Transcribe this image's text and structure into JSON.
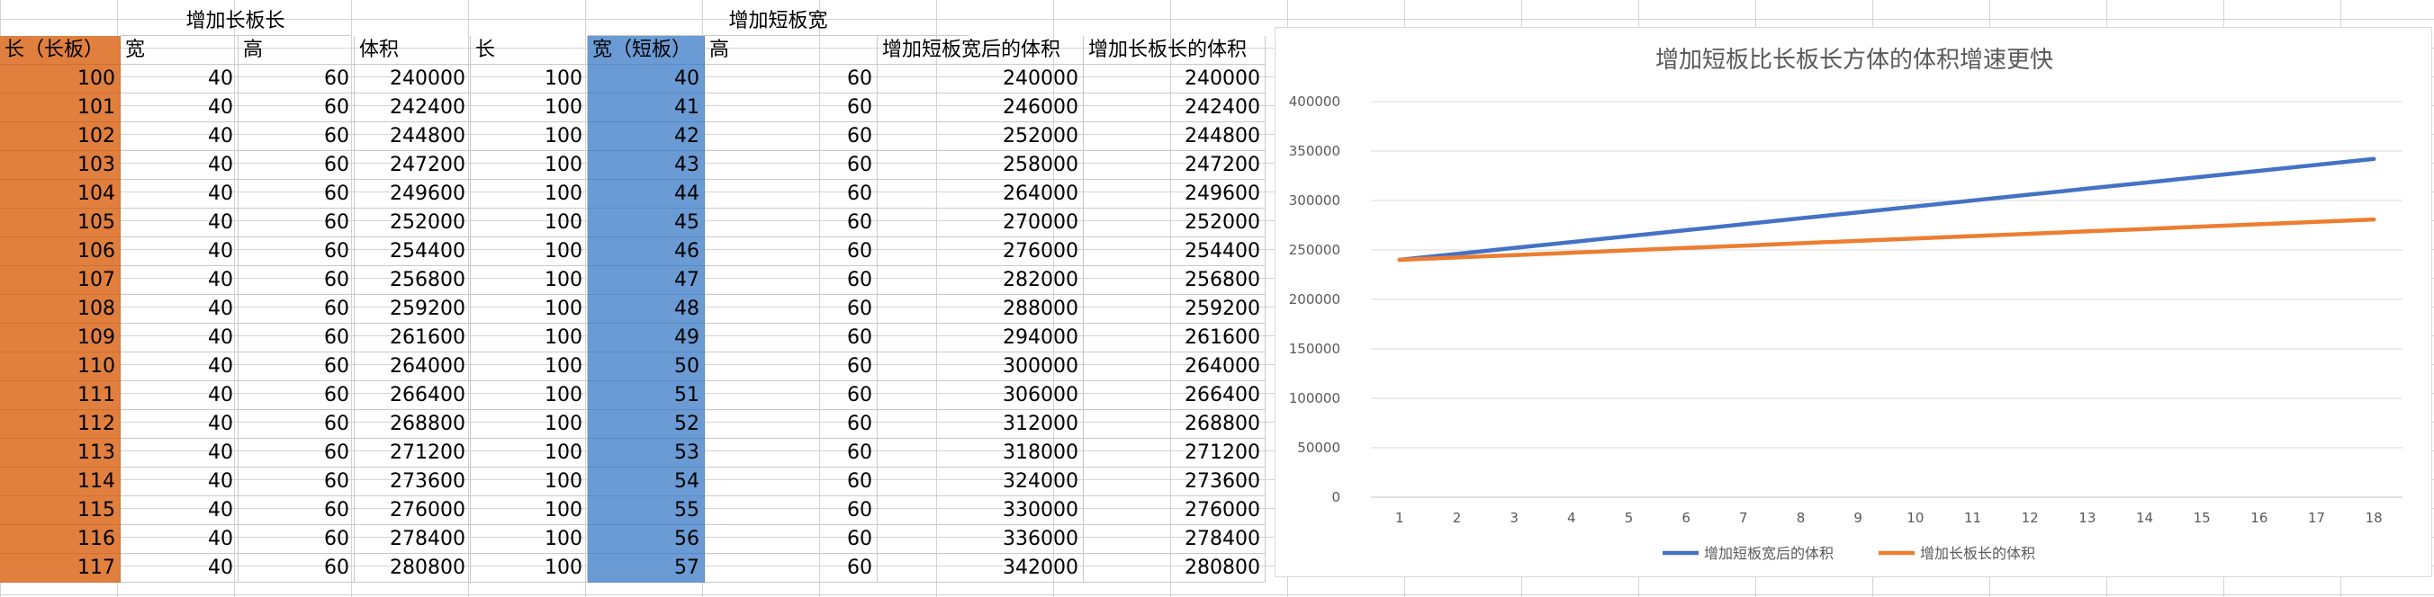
{
  "sheet": {
    "group_long_title": "增加长板长",
    "group_short_title": "增加短板宽",
    "headers": [
      "长（长板）",
      "宽",
      "高",
      "体积",
      "长",
      "宽（短板）",
      "高",
      "增加短板宽后的体积",
      "增加长板长的体积"
    ],
    "rows": [
      [
        "100",
        "40",
        "60",
        "240000",
        "100",
        "40",
        "60",
        "240000",
        "240000"
      ],
      [
        "101",
        "40",
        "60",
        "242400",
        "100",
        "41",
        "60",
        "246000",
        "242400"
      ],
      [
        "102",
        "40",
        "60",
        "244800",
        "100",
        "42",
        "60",
        "252000",
        "244800"
      ],
      [
        "103",
        "40",
        "60",
        "247200",
        "100",
        "43",
        "60",
        "258000",
        "247200"
      ],
      [
        "104",
        "40",
        "60",
        "249600",
        "100",
        "44",
        "60",
        "264000",
        "249600"
      ],
      [
        "105",
        "40",
        "60",
        "252000",
        "100",
        "45",
        "60",
        "270000",
        "252000"
      ],
      [
        "106",
        "40",
        "60",
        "254400",
        "100",
        "46",
        "60",
        "276000",
        "254400"
      ],
      [
        "107",
        "40",
        "60",
        "256800",
        "100",
        "47",
        "60",
        "282000",
        "256800"
      ],
      [
        "108",
        "40",
        "60",
        "259200",
        "100",
        "48",
        "60",
        "288000",
        "259200"
      ],
      [
        "109",
        "40",
        "60",
        "261600",
        "100",
        "49",
        "60",
        "294000",
        "261600"
      ],
      [
        "110",
        "40",
        "60",
        "264000",
        "100",
        "50",
        "60",
        "300000",
        "264000"
      ],
      [
        "111",
        "40",
        "60",
        "266400",
        "100",
        "51",
        "60",
        "306000",
        "266400"
      ],
      [
        "112",
        "40",
        "60",
        "268800",
        "100",
        "52",
        "60",
        "312000",
        "268800"
      ],
      [
        "113",
        "40",
        "60",
        "271200",
        "100",
        "53",
        "60",
        "318000",
        "271200"
      ],
      [
        "114",
        "40",
        "60",
        "273600",
        "100",
        "54",
        "60",
        "324000",
        "273600"
      ],
      [
        "115",
        "40",
        "60",
        "276000",
        "100",
        "55",
        "60",
        "330000",
        "276000"
      ],
      [
        "116",
        "40",
        "60",
        "278400",
        "100",
        "56",
        "60",
        "336000",
        "278400"
      ],
      [
        "117",
        "40",
        "60",
        "280800",
        "100",
        "57",
        "60",
        "342000",
        "280800"
      ]
    ]
  },
  "chart_data": {
    "type": "line",
    "title": "增加短板比长板长方体的体积增速更快",
    "x": [
      1,
      2,
      3,
      4,
      5,
      6,
      7,
      8,
      9,
      10,
      11,
      12,
      13,
      14,
      15,
      16,
      17,
      18
    ],
    "ylim": [
      0,
      400000
    ],
    "yticks": [
      0,
      50000,
      100000,
      150000,
      200000,
      250000,
      300000,
      350000,
      400000
    ],
    "grid": true,
    "legend": "bottom",
    "series": [
      {
        "name": "增加短板宽后的体积",
        "color": "#4472c4",
        "values": [
          240000,
          246000,
          252000,
          258000,
          264000,
          270000,
          276000,
          282000,
          288000,
          294000,
          300000,
          306000,
          312000,
          318000,
          324000,
          330000,
          336000,
          342000
        ]
      },
      {
        "name": "增加长板长的体积",
        "color": "#ed7d31",
        "values": [
          240000,
          242400,
          244800,
          247200,
          249600,
          252000,
          254400,
          256800,
          259200,
          261600,
          264000,
          266400,
          268800,
          271200,
          273600,
          276000,
          278400,
          280800
        ]
      }
    ]
  }
}
